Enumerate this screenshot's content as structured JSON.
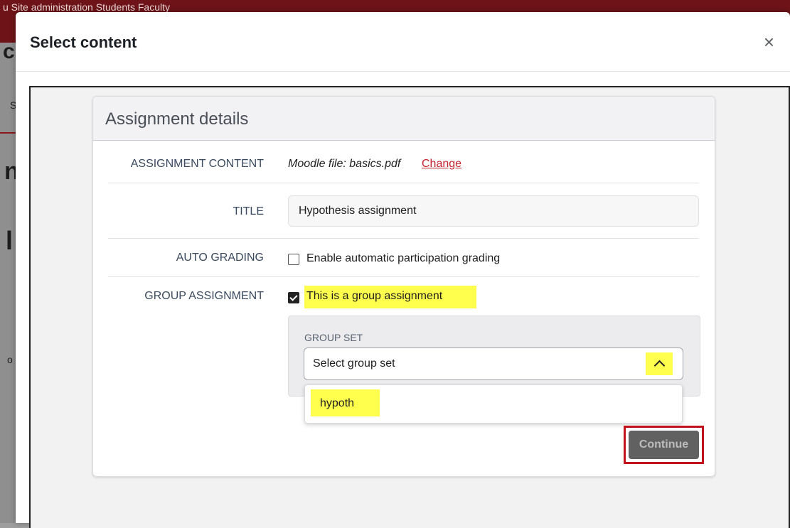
{
  "background": {
    "topbar_text": "u    Site administration    Students    Faculty",
    "fragments": [
      "cs",
      "S",
      "n",
      "l",
      "o"
    ]
  },
  "modal": {
    "title": "Select content",
    "close_label": "×"
  },
  "card": {
    "title": "Assignment details",
    "assignment_content": {
      "label": "ASSIGNMENT CONTENT",
      "value": "Moodle file: basics.pdf",
      "change_link": "Change"
    },
    "title_field": {
      "label": "TITLE",
      "value": "Hypothesis assignment"
    },
    "auto_grading": {
      "label": "AUTO GRADING",
      "checkbox_label": "Enable automatic participation grading",
      "checked": false
    },
    "group_assignment": {
      "label": "GROUP ASSIGNMENT",
      "checkbox_label": "This is a group assignment",
      "checked": true,
      "group_set": {
        "label": "GROUP SET",
        "placeholder": "Select group set",
        "options": [
          "hypoth"
        ]
      }
    },
    "continue_button": "Continue"
  },
  "colors": {
    "highlight": "#ffff4d",
    "link": "#c4232e",
    "outline": "#c2121b",
    "button_bg": "#616161"
  }
}
